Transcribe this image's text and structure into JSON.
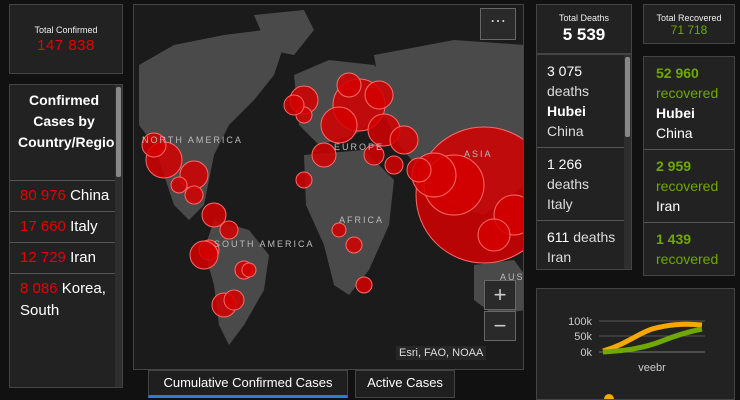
{
  "total_confirmed": {
    "label": "Total Confirmed",
    "value": "147 838"
  },
  "confirmed_list": {
    "title": "Confirmed Cases by Country/Region/Sovereignty",
    "items": [
      {
        "count": "80 976",
        "place": "China"
      },
      {
        "count": "17 660",
        "place": "Italy"
      },
      {
        "count": "12 729",
        "place": "Iran"
      },
      {
        "count": "8 086",
        "place": "Korea, South"
      }
    ]
  },
  "map": {
    "labels": [
      "NORTH AMERICA",
      "EUROPE",
      "ASIA",
      "AFRICA",
      "SOUTH AMERICA",
      "AUS"
    ],
    "attribution": "Esri, FAO, NOAA",
    "more_label": "⋯",
    "zoom_in_label": "+",
    "zoom_out_label": "−",
    "bubble_color": "#d40000"
  },
  "tabs": [
    {
      "label": "Cumulative Confirmed Cases",
      "active": true
    },
    {
      "label": "Active Cases",
      "active": false
    }
  ],
  "total_deaths": {
    "label": "Total Deaths",
    "value": "5 539"
  },
  "deaths_list": [
    {
      "count": "3 075",
      "suffix": "deaths",
      "place_bold": "Hubei",
      "place_rest": "China"
    },
    {
      "count": "1 266",
      "suffix": "deaths",
      "place_bold": "",
      "place_rest": "Italy"
    },
    {
      "count": "611",
      "suffix": "deaths",
      "place_bold": "",
      "place_rest": "Iran"
    }
  ],
  "total_recovered": {
    "label": "Total Recovered",
    "value": "71 718"
  },
  "recovered_list": [
    {
      "count": "52 960",
      "suffix": "recovered",
      "place_bold": "Hubei",
      "place_rest": "China"
    },
    {
      "count": "2 959",
      "suffix": "recovered",
      "place_bold": "",
      "place_rest": "Iran"
    },
    {
      "count": "1 439",
      "suffix": "recovered",
      "place_bold": "",
      "place_rest": ""
    }
  ],
  "mini_chart": {
    "y_ticks": [
      "100k",
      "50k",
      "0k"
    ],
    "x_label": "veebr",
    "colors": {
      "orange": "#f7a800",
      "green": "#70a800"
    }
  },
  "colors": {
    "red": "#e60000",
    "green": "#70a800",
    "panel": "#222222",
    "background": "#111111"
  }
}
